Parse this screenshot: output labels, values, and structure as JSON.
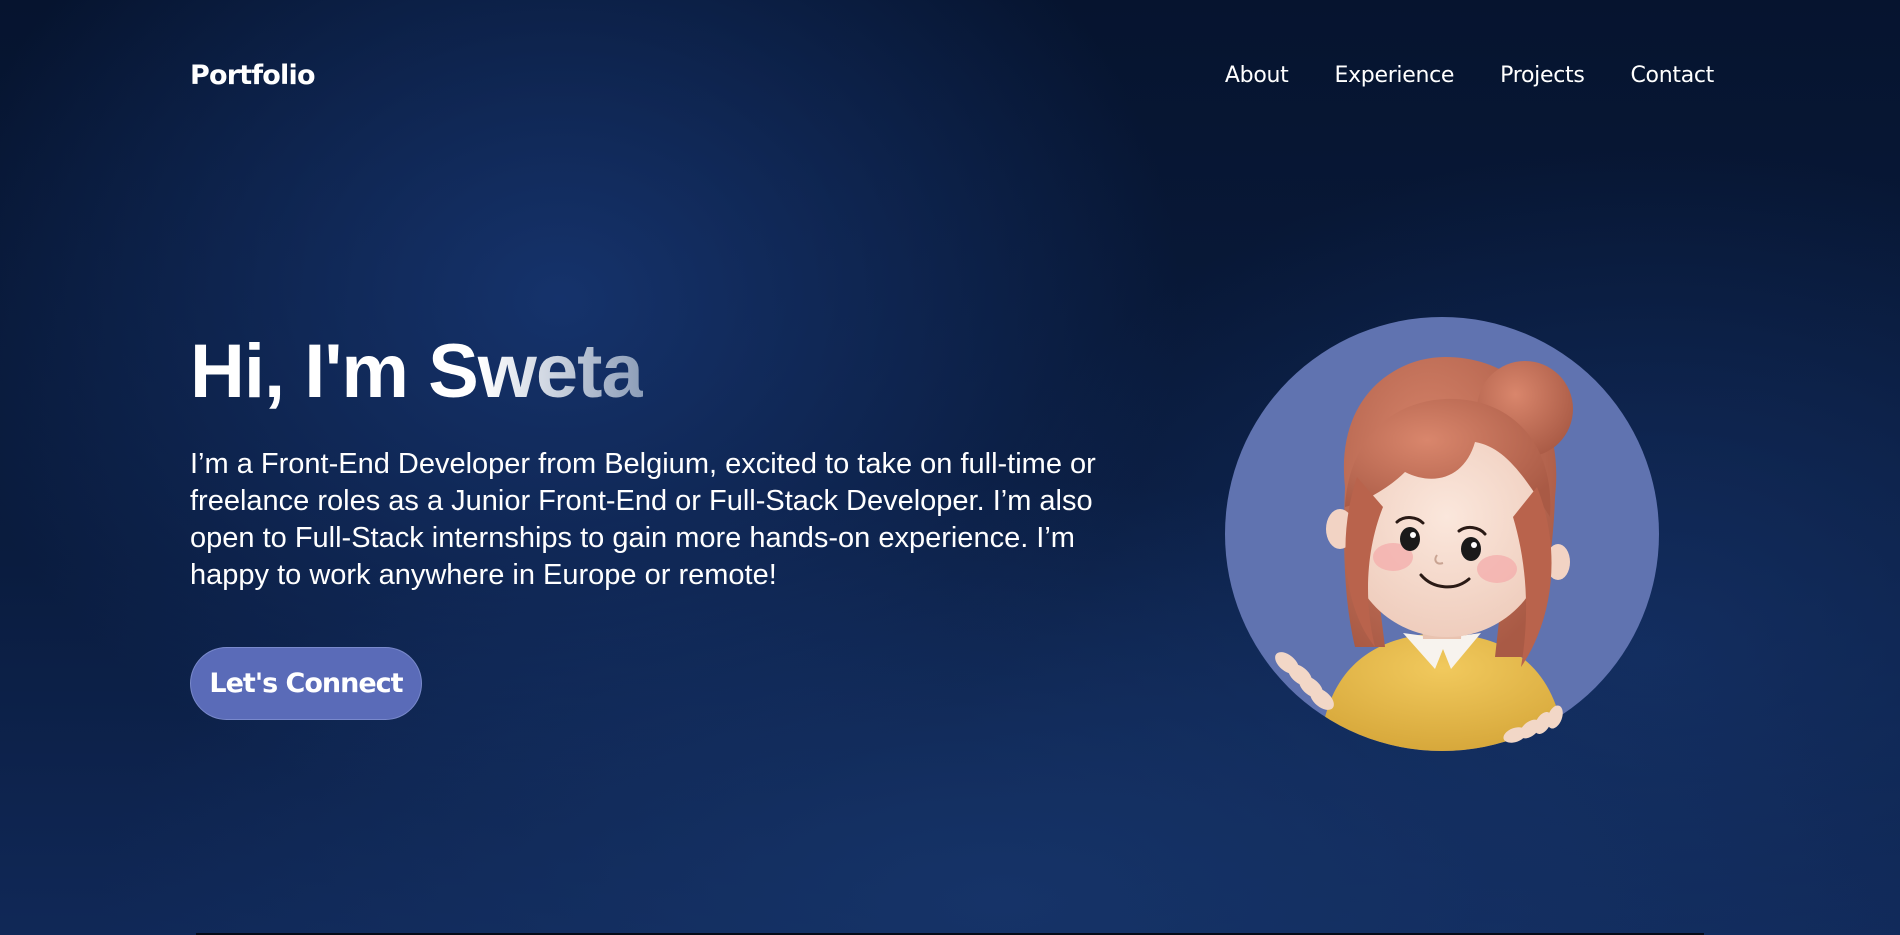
{
  "nav": {
    "logo": "Portfolio",
    "links": [
      "About",
      "Experience",
      "Projects",
      "Contact"
    ]
  },
  "hero": {
    "title": "Hi, I'm Sweta",
    "description": "I’m a Front-End Developer from Belgium, excited to take on full-time or freelance roles as a Junior Front-End or Full-Stack Developer. I’m also open to Full-Stack internships to gain more hands-on experience. I’m happy to work anywhere in Europe or remote!",
    "cta_label": "Let's Connect"
  },
  "colors": {
    "background": "#0a1c3f",
    "cta": "#5a6bb8",
    "avatar_circle": "#6073b0",
    "hair": "#c0705a",
    "shirt": "#e6b94c"
  },
  "icons": {
    "avatar": "cartoon-girl-avatar"
  }
}
